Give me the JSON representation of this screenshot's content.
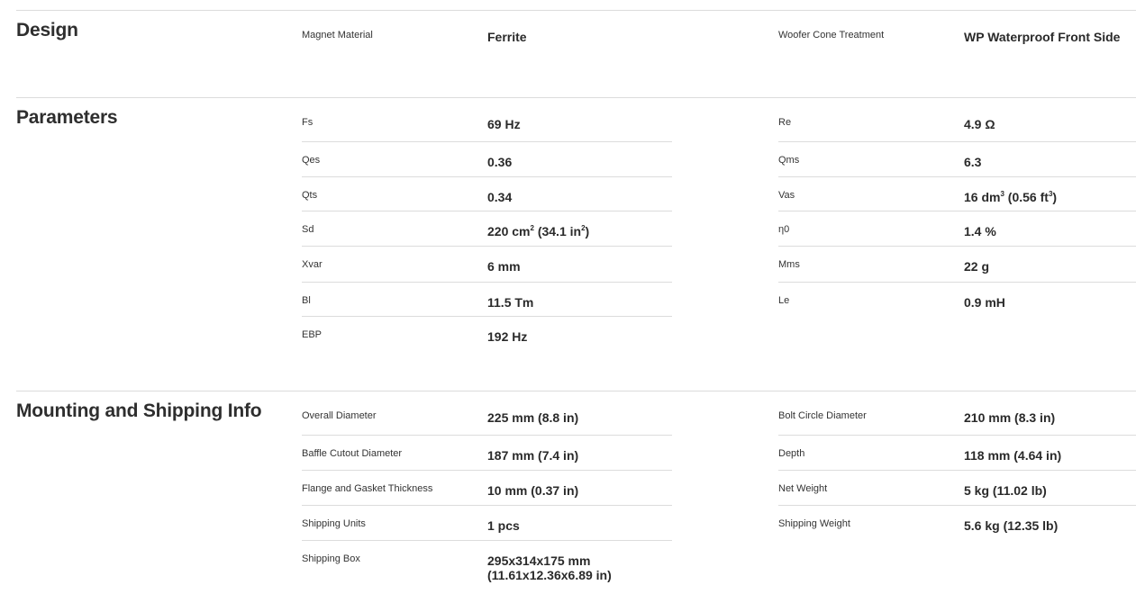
{
  "design": {
    "title": "Design",
    "left": [
      {
        "label": "Magnet Material",
        "value": "Ferrite"
      }
    ],
    "right": [
      {
        "label": "Woofer Cone Treatment",
        "value": "WP Waterproof Front Side"
      }
    ]
  },
  "parameters": {
    "title": "Parameters",
    "left": [
      {
        "label": "Fs",
        "value": "69 Hz"
      },
      {
        "label": "Qes",
        "value": "0.36"
      },
      {
        "label": "Qts",
        "value": "0.34"
      },
      {
        "label": "Sd",
        "value_pre": "220 cm",
        "sup1": "2",
        "value_mid": " (34.1 in",
        "sup2": "2",
        "value_post": ")"
      },
      {
        "label": "Xvar",
        "value": "6 mm"
      },
      {
        "label": "Bl",
        "value": "11.5 Tm"
      },
      {
        "label": "EBP",
        "value": "192 Hz"
      }
    ],
    "right": [
      {
        "label": "Re",
        "value": "4.9 Ω"
      },
      {
        "label": "Qms",
        "value": "6.3"
      },
      {
        "label": "Vas",
        "value_pre": "16 dm",
        "sup1": "3",
        "value_mid": " (0.56 ft",
        "sup2": "3",
        "value_post": ")"
      },
      {
        "label": "η0",
        "value": "1.4 %"
      },
      {
        "label": "Mms",
        "value": "22 g"
      },
      {
        "label": "Le",
        "value": "0.9 mH"
      }
    ]
  },
  "mounting": {
    "title": "Mounting and Shipping Info",
    "left": [
      {
        "label": "Overall Diameter",
        "value": "225 mm (8.8 in)"
      },
      {
        "label": "Baffle Cutout Diameter",
        "value": "187 mm (7.4 in)"
      },
      {
        "label": "Flange and Gasket Thickness",
        "value": "10 mm (0.37 in)"
      },
      {
        "label": "Shipping Units",
        "value": "1 pcs"
      },
      {
        "label": "Shipping Box",
        "value_line1": "295x314x175 mm",
        "value_line2": "(11.61x12.36x6.89 in)"
      }
    ],
    "right": [
      {
        "label": "Bolt Circle Diameter",
        "value": "210 mm (8.3 in)"
      },
      {
        "label": "Depth",
        "value": "118 mm (4.64 in)"
      },
      {
        "label": "Net Weight",
        "value": "5 kg (11.02 lb)"
      },
      {
        "label": "Shipping Weight",
        "value": "5.6 kg (12.35 lb)"
      }
    ]
  }
}
